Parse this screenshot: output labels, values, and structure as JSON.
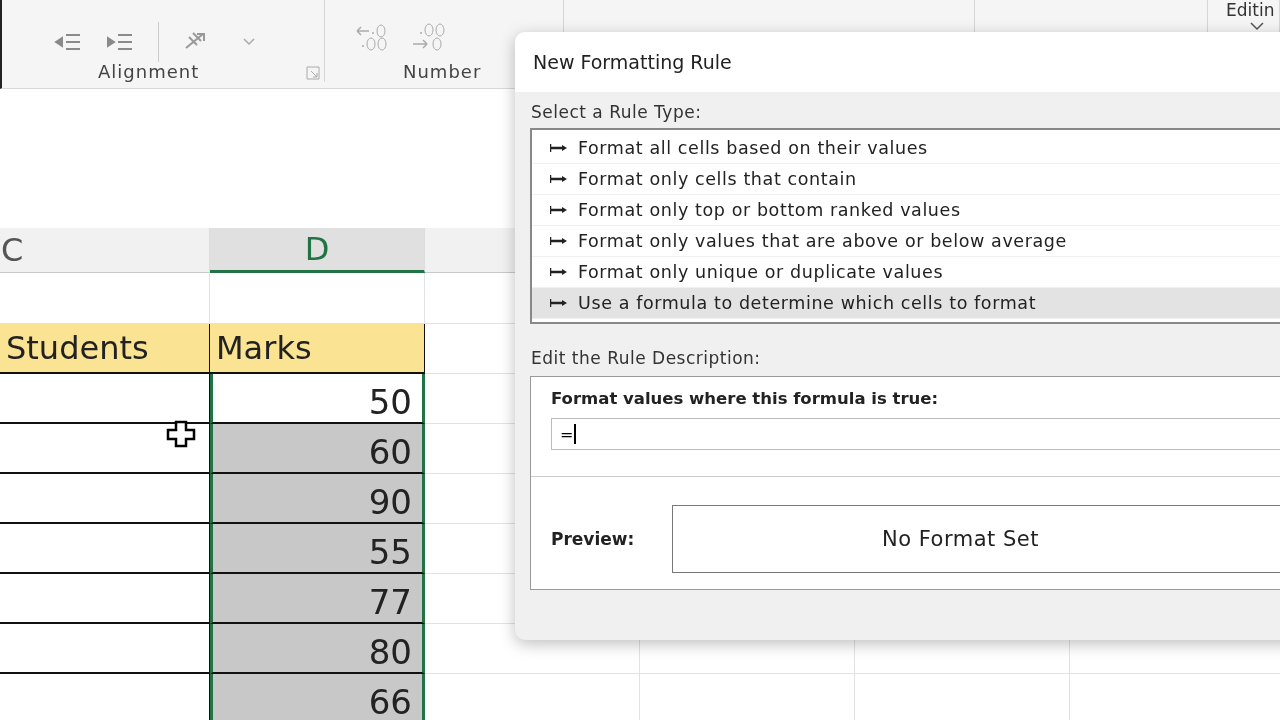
{
  "ribbon": {
    "groups": [
      {
        "label": "Alignment"
      },
      {
        "label": "Number"
      }
    ],
    "editing_label": "Editin"
  },
  "sheet": {
    "columns": [
      {
        "label": "C",
        "selected": false
      },
      {
        "label": "D",
        "selected": true
      }
    ],
    "header_row": [
      "Students",
      "Marks"
    ],
    "marks": [
      {
        "value": "50",
        "active": true
      },
      {
        "value": "60",
        "active": false
      },
      {
        "value": "90",
        "active": false
      },
      {
        "value": "55",
        "active": false
      },
      {
        "value": "77",
        "active": false
      },
      {
        "value": "80",
        "active": false
      },
      {
        "value": "66",
        "active": false
      }
    ]
  },
  "dialog": {
    "title": "New Formatting Rule",
    "rule_type_label": "Select a Rule Type:",
    "rule_types": [
      {
        "label": "Format all cells based on their values",
        "selected": false
      },
      {
        "label": "Format only cells that contain",
        "selected": false
      },
      {
        "label": "Format only top or bottom ranked values",
        "selected": false
      },
      {
        "label": "Format only values that are above or below average",
        "selected": false
      },
      {
        "label": "Format only unique or duplicate values",
        "selected": false
      },
      {
        "label": "Use a formula to determine which cells to format",
        "selected": true
      }
    ],
    "description_label": "Edit the Rule Description:",
    "formula_label": "Format values where this formula is true:",
    "formula_value": "=",
    "preview_label": "Preview:",
    "preview_text": "No Format Set"
  }
}
